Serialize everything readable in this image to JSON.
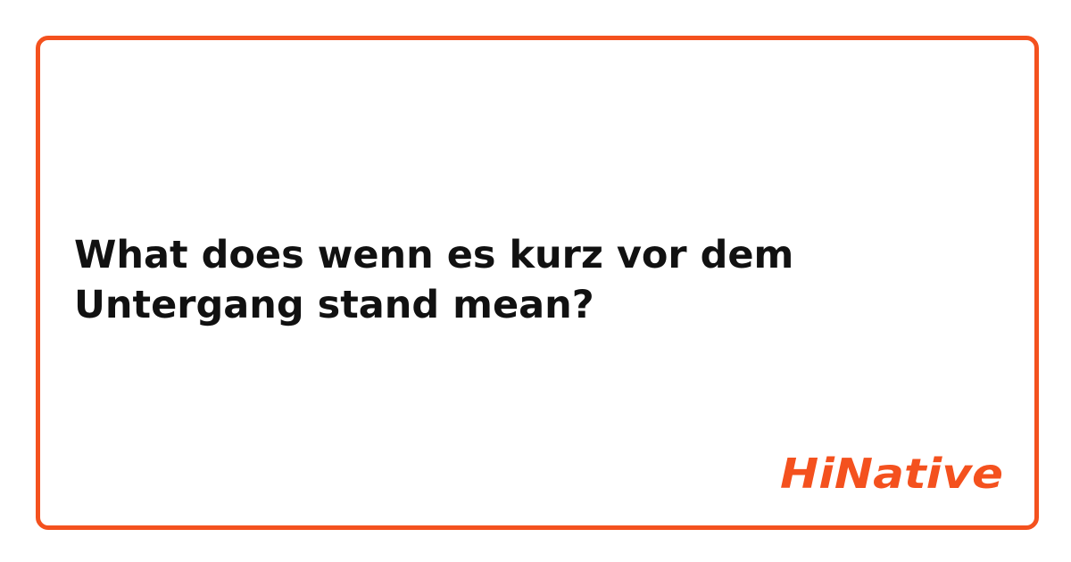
{
  "question": {
    "text": "What does wenn es kurz vor dem Untergang stand mean?"
  },
  "brand": {
    "logo_text": "HiNative",
    "accent_color": "#f4511e"
  }
}
